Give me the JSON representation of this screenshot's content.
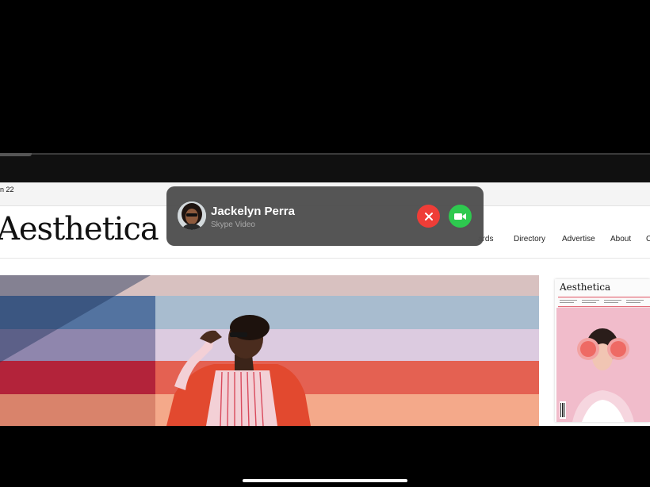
{
  "status_bar": {
    "date": "n 22"
  },
  "site": {
    "logo": "Aesthetica",
    "nav": [
      "ards",
      "Directory",
      "Advertise",
      "About"
    ]
  },
  "magazine": {
    "title": "Aesthetica"
  },
  "call": {
    "caller_name": "Jackelyn Perra",
    "app_label": "Skype Video",
    "decline_icon": "close-icon",
    "accept_icon": "video-camera-icon"
  },
  "colors": {
    "decline": "#ef3d37",
    "accept": "#2ec94f",
    "banner": "#505050"
  }
}
